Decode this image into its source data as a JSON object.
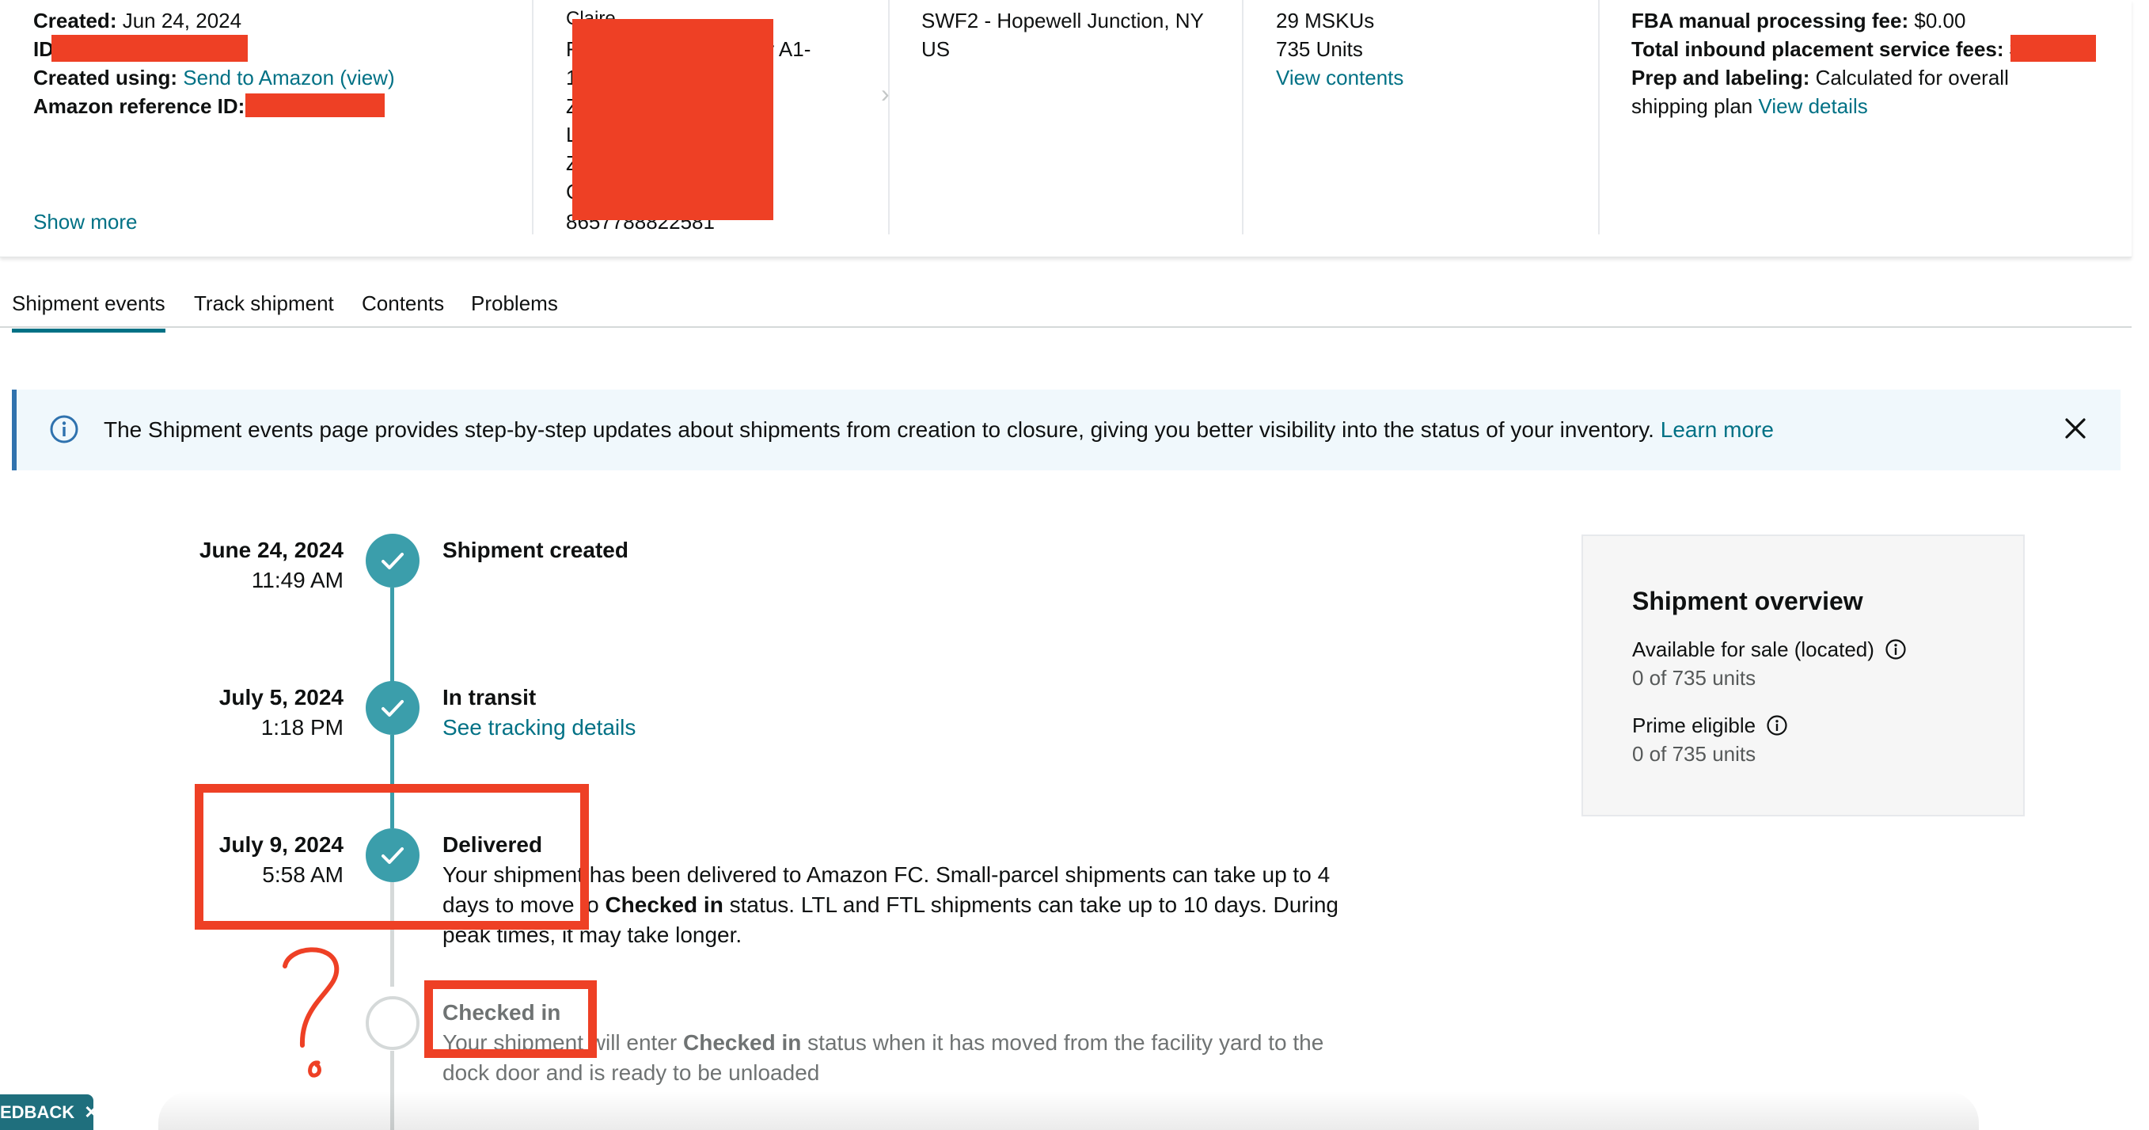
{
  "card": {
    "col1": {
      "created_label": "Created:",
      "created_value": "Jun 24, 2024",
      "id_label": "ID",
      "created_using_label": "Created using:",
      "created_using_link": "Send to Amazon (view)",
      "amazon_ref_label": "Amazon reference ID:",
      "show_more": "Show more"
    },
    "col2": {
      "line1": "Claire",
      "line2_left": "F",
      "line2_right": "er A1-",
      "line3": "1",
      "line4": "Z",
      "line5": "L",
      "line6": "Z",
      "line7": "C",
      "line8": "8657788822581"
    },
    "col3": {
      "destination": "SWF2 - Hopewell Junction, NY",
      "country": "US"
    },
    "col4": {
      "mskus": "29 MSKUs",
      "units": "735 Units",
      "view_contents": "View contents"
    },
    "col5": {
      "fba_fee_label": "FBA manual processing fee:",
      "fba_fee_value": "$0.00",
      "placement_label": "Total inbound placement service fees:",
      "placement_value": "$",
      "prep_label": "Prep and labeling:",
      "prep_value": "Calculated for overall",
      "prep_value2": "shipping plan",
      "view_details": "View details"
    }
  },
  "tabs": [
    {
      "label": "Shipment events",
      "active": true
    },
    {
      "label": "Track shipment"
    },
    {
      "label": "Contents"
    },
    {
      "label": "Problems"
    }
  ],
  "banner": {
    "text": "The Shipment events page provides step-by-step updates about shipments from creation to closure, giving you better visibility into the status of your inventory.",
    "link": "Learn more",
    "info_icon": "info-icon",
    "close_icon": "close-icon"
  },
  "events": {
    "created": {
      "date": "June 24, 2024",
      "time": "11:49 AM",
      "title": "Shipment created"
    },
    "transit": {
      "date": "July 5, 2024",
      "time": "1:18 PM",
      "title": "In transit",
      "link": "See tracking details"
    },
    "delivered": {
      "date": "July 9, 2024",
      "time": "5:58 AM",
      "title": "Delivered",
      "desc_a": "Your shipment has been delivered to Amazon FC. Small-parcel shipments can take up to 4",
      "desc_b1": "days to move to ",
      "desc_b_bold": "Checked in",
      "desc_b2": " status. LTL and FTL shipments can take up to 10 days. During",
      "desc_c": "peak times, it may take longer."
    },
    "checked_in": {
      "title": "Checked in",
      "desc_a1": "Your shipment will enter ",
      "desc_a_bold": "Checked in",
      "desc_a2": " status when it has moved from the facility yard to the",
      "desc_b": "dock door and is ready to be unloaded"
    }
  },
  "overview": {
    "title": "Shipment overview",
    "available_label": "Available for sale (located)",
    "available_value": "0 of 735 units",
    "prime_label": "Prime eligible",
    "prime_value": "0 of 735 units"
  },
  "annotation": {
    "question_mark": "?"
  },
  "feedback": {
    "label": "EDBACK"
  },
  "colors": {
    "accent": "#007185",
    "timeline": "#3b9eab",
    "annotation": "#ee4025",
    "banner_bg": "#f0f8fc"
  }
}
